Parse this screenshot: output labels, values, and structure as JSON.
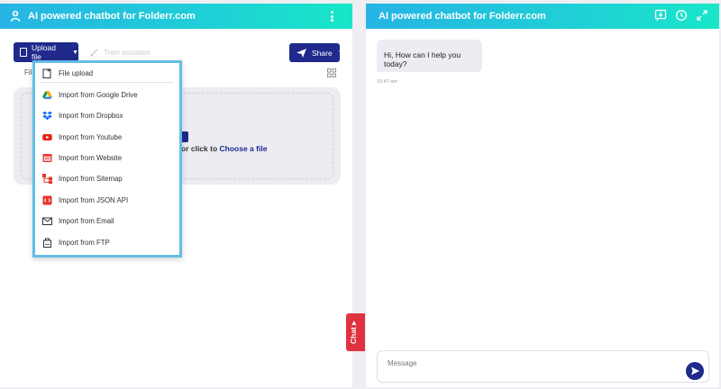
{
  "left_panel": {
    "title": "AI powered chatbot for Folderr.com",
    "toolbar": {
      "upload_label": "Upload file",
      "train_label": "Train assistant",
      "share_label": "Share"
    },
    "files_tab_label": "Fil",
    "dropzone": {
      "text": "or click to ",
      "link": "Choose a file"
    },
    "upload_menu": [
      {
        "label": "File upload",
        "icon": "file-add-icon"
      },
      {
        "label": "Import from Google Drive",
        "icon": "google-drive-icon"
      },
      {
        "label": "Import from Dropbox",
        "icon": "dropbox-icon"
      },
      {
        "label": "Import from Youtube",
        "icon": "youtube-icon"
      },
      {
        "label": "Import from Website",
        "icon": "website-icon"
      },
      {
        "label": "Import from Sitemap",
        "icon": "sitemap-icon"
      },
      {
        "label": "Import from JSON API",
        "icon": "json-api-icon"
      },
      {
        "label": "Import from Email",
        "icon": "email-icon"
      },
      {
        "label": "Import from FTP",
        "icon": "ftp-icon"
      }
    ]
  },
  "chat_tab": {
    "label": "Chat ▸"
  },
  "right_panel": {
    "title": "AI powered chatbot for Folderr.com",
    "messages": [
      {
        "text": "Hi, How can I help you today?",
        "time": "10:47 am"
      }
    ],
    "composer": {
      "placeholder": "Message"
    }
  },
  "colors": {
    "accent": "#1f2a8c",
    "header_gradient_start": "#26b4e4",
    "header_gradient_end": "#18e6c8",
    "chat_tab": "#e0323f",
    "menu_border": "#65bde8"
  }
}
